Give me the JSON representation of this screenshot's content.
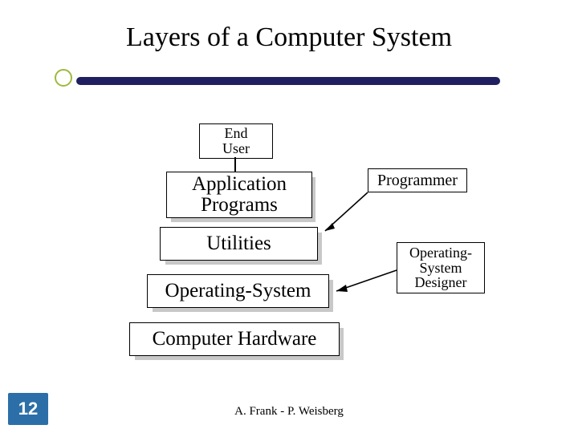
{
  "title": "Layers of a Computer System",
  "boxes": {
    "end_user": "End\nUser",
    "app_programs": "Application\nPrograms",
    "utilities": "Utilities",
    "os": "Operating-System",
    "hardware": "Computer Hardware",
    "programmer": "Programmer",
    "os_designer": "Operating-\nSystem\nDesigner"
  },
  "footer": "A. Frank - P. Weisberg",
  "slide_number": "12"
}
